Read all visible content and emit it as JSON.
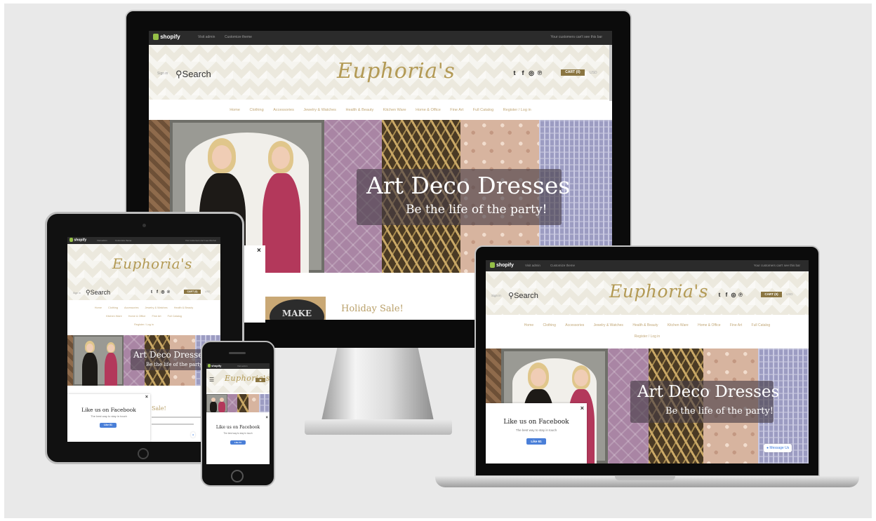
{
  "site": {
    "shopify": "shopify",
    "admin_visit": "Visit admin",
    "admin_customize": "Customize theme",
    "admin_notice": "Your customers can't see this bar",
    "logo": "Euphoria's",
    "search": "Search",
    "sign_in": "Sign in",
    "cart": "CART (0)",
    "currency": "USD",
    "social_icons": [
      "twitter-icon",
      "facebook-icon",
      "instagram-icon",
      "pinterest-icon"
    ],
    "nav": [
      "Home",
      "Clothing",
      "Accessories",
      "Jewelry & Watches",
      "Health & Beauty",
      "Kitchen Ware",
      "Home & Office",
      "Fine Art",
      "Full Catalog",
      "Register / Log in"
    ],
    "hero_title": "Art Deco Dresses",
    "hero_subtitle": "Be the life of the party!",
    "holiday": "Holiday Sale!",
    "fb_title": "Like us on Facebook",
    "fb_sub": "The best way to stay in touch",
    "fb_button": "Like 61",
    "message_us": "Message Us",
    "close": "×",
    "tablet_partial": "Sale!"
  },
  "colors": {
    "accent_gold": "#b39a55",
    "cart_bg": "#8a7541",
    "fb_blue": "#4a7fd8",
    "adminbar": "#2b2b2b"
  }
}
